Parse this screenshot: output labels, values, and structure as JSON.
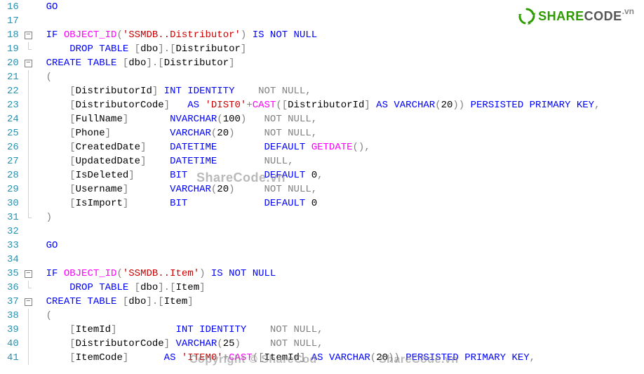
{
  "logo": {
    "brand_left": "SHARE",
    "brand_right": "CODE",
    "tld": ".vn"
  },
  "watermarks": {
    "wm1": "ShareCode.vn",
    "wm2": "Copyright © ShareCod",
    "wm3": "ShareCode.vn"
  },
  "gutter_start": 16,
  "lines": [
    {
      "n": 16,
      "fold": "",
      "tokens": [
        [
          "kw",
          "GO"
        ]
      ]
    },
    {
      "n": 17,
      "fold": "",
      "tokens": []
    },
    {
      "n": 18,
      "fold": "box",
      "tokens": [
        [
          "kw",
          "IF "
        ],
        [
          "fn",
          "OBJECT_ID"
        ],
        [
          "op",
          "("
        ],
        [
          "str",
          "'SSMDB..Distributor'"
        ],
        [
          "op",
          ") "
        ],
        [
          "kw",
          "IS NOT NULL"
        ]
      ]
    },
    {
      "n": 19,
      "fold": "end",
      "tokens": [
        [
          "",
          "    "
        ],
        [
          "kw",
          "DROP TABLE "
        ],
        [
          "op",
          "["
        ],
        [
          "ident",
          "dbo"
        ],
        [
          "op",
          "].["
        ],
        [
          "ident",
          "Distributor"
        ],
        [
          "op",
          "]"
        ]
      ]
    },
    {
      "n": 20,
      "fold": "box",
      "tokens": [
        [
          "kw",
          "CREATE TABLE "
        ],
        [
          "op",
          "["
        ],
        [
          "ident",
          "dbo"
        ],
        [
          "op",
          "].["
        ],
        [
          "ident",
          "Distributor"
        ],
        [
          "op",
          "]"
        ]
      ]
    },
    {
      "n": 21,
      "fold": "line",
      "tokens": [
        [
          "op",
          "("
        ]
      ]
    },
    {
      "n": 22,
      "fold": "line",
      "tokens": [
        [
          "",
          "    "
        ],
        [
          "op",
          "["
        ],
        [
          "ident",
          "DistributorId"
        ],
        [
          "op",
          "] "
        ],
        [
          "kw",
          "INT IDENTITY    "
        ],
        [
          "op",
          "NOT NULL,"
        ]
      ]
    },
    {
      "n": 23,
      "fold": "line",
      "tokens": [
        [
          "",
          "    "
        ],
        [
          "op",
          "["
        ],
        [
          "ident",
          "DistributorCode"
        ],
        [
          "op",
          "]   "
        ],
        [
          "kw",
          "AS "
        ],
        [
          "str",
          "'DIST0'"
        ],
        [
          "op",
          "+"
        ],
        [
          "fn",
          "CAST"
        ],
        [
          "op",
          "(["
        ],
        [
          "ident",
          "DistributorId"
        ],
        [
          "op",
          "] "
        ],
        [
          "kw",
          "AS VARCHAR"
        ],
        [
          "op",
          "("
        ],
        [
          "num",
          "20"
        ],
        [
          "op",
          ")) "
        ],
        [
          "kw",
          "PERSISTED PRIMARY KEY"
        ],
        [
          "op",
          ","
        ]
      ]
    },
    {
      "n": 24,
      "fold": "line",
      "tokens": [
        [
          "",
          "    "
        ],
        [
          "op",
          "["
        ],
        [
          "ident",
          "FullName"
        ],
        [
          "op",
          "]       "
        ],
        [
          "kw",
          "NVARCHAR"
        ],
        [
          "op",
          "("
        ],
        [
          "num",
          "100"
        ],
        [
          "op",
          ")   "
        ],
        [
          "op",
          "NOT NULL,"
        ]
      ]
    },
    {
      "n": 25,
      "fold": "line",
      "tokens": [
        [
          "",
          "    "
        ],
        [
          "op",
          "["
        ],
        [
          "ident",
          "Phone"
        ],
        [
          "op",
          "]          "
        ],
        [
          "kw",
          "VARCHAR"
        ],
        [
          "op",
          "("
        ],
        [
          "num",
          "20"
        ],
        [
          "op",
          ")     "
        ],
        [
          "op",
          "NOT NULL,"
        ]
      ]
    },
    {
      "n": 26,
      "fold": "line",
      "tokens": [
        [
          "",
          "    "
        ],
        [
          "op",
          "["
        ],
        [
          "ident",
          "CreatedDate"
        ],
        [
          "op",
          "]    "
        ],
        [
          "kw",
          "DATETIME        DEFAULT "
        ],
        [
          "fn",
          "GETDATE"
        ],
        [
          "op",
          "(),"
        ]
      ]
    },
    {
      "n": 27,
      "fold": "line",
      "tokens": [
        [
          "",
          "    "
        ],
        [
          "op",
          "["
        ],
        [
          "ident",
          "UpdatedDate"
        ],
        [
          "op",
          "]    "
        ],
        [
          "kw",
          "DATETIME        "
        ],
        [
          "op",
          "NULL,"
        ]
      ]
    },
    {
      "n": 28,
      "fold": "line",
      "tokens": [
        [
          "",
          "    "
        ],
        [
          "op",
          "["
        ],
        [
          "ident",
          "IsDeleted"
        ],
        [
          "op",
          "]      "
        ],
        [
          "kw",
          "BIT             DEFAULT "
        ],
        [
          "num",
          "0"
        ],
        [
          "op",
          ","
        ]
      ]
    },
    {
      "n": 29,
      "fold": "line",
      "tokens": [
        [
          "",
          "    "
        ],
        [
          "op",
          "["
        ],
        [
          "ident",
          "Username"
        ],
        [
          "op",
          "]       "
        ],
        [
          "kw",
          "VARCHAR"
        ],
        [
          "op",
          "("
        ],
        [
          "num",
          "20"
        ],
        [
          "op",
          ")     "
        ],
        [
          "op",
          "NOT NULL,"
        ]
      ]
    },
    {
      "n": 30,
      "fold": "line",
      "tokens": [
        [
          "",
          "    "
        ],
        [
          "op",
          "["
        ],
        [
          "ident",
          "IsImport"
        ],
        [
          "op",
          "]       "
        ],
        [
          "kw",
          "BIT             DEFAULT "
        ],
        [
          "num",
          "0"
        ]
      ]
    },
    {
      "n": 31,
      "fold": "end",
      "tokens": [
        [
          "op",
          ")"
        ]
      ]
    },
    {
      "n": 32,
      "fold": "",
      "tokens": []
    },
    {
      "n": 33,
      "fold": "",
      "tokens": [
        [
          "kw",
          "GO"
        ]
      ]
    },
    {
      "n": 34,
      "fold": "",
      "tokens": []
    },
    {
      "n": 35,
      "fold": "box",
      "tokens": [
        [
          "kw",
          "IF "
        ],
        [
          "fn",
          "OBJECT_ID"
        ],
        [
          "op",
          "("
        ],
        [
          "str",
          "'SSMDB..Item'"
        ],
        [
          "op",
          ") "
        ],
        [
          "kw",
          "IS NOT NULL"
        ]
      ]
    },
    {
      "n": 36,
      "fold": "end",
      "tokens": [
        [
          "",
          "    "
        ],
        [
          "kw",
          "DROP TABLE "
        ],
        [
          "op",
          "["
        ],
        [
          "ident",
          "dbo"
        ],
        [
          "op",
          "].["
        ],
        [
          "ident",
          "Item"
        ],
        [
          "op",
          "]"
        ]
      ]
    },
    {
      "n": 37,
      "fold": "box",
      "tokens": [
        [
          "kw",
          "CREATE TABLE "
        ],
        [
          "op",
          "["
        ],
        [
          "ident",
          "dbo"
        ],
        [
          "op",
          "].["
        ],
        [
          "ident",
          "Item"
        ],
        [
          "op",
          "]"
        ]
      ]
    },
    {
      "n": 38,
      "fold": "line",
      "tokens": [
        [
          "op",
          "("
        ]
      ]
    },
    {
      "n": 39,
      "fold": "line",
      "tokens": [
        [
          "",
          "    "
        ],
        [
          "op",
          "["
        ],
        [
          "ident",
          "ItemId"
        ],
        [
          "op",
          "]          "
        ],
        [
          "kw",
          "INT IDENTITY    "
        ],
        [
          "op",
          "NOT NULL,"
        ]
      ]
    },
    {
      "n": 40,
      "fold": "line",
      "tokens": [
        [
          "",
          "    "
        ],
        [
          "op",
          "["
        ],
        [
          "ident",
          "DistributorCode"
        ],
        [
          "op",
          "] "
        ],
        [
          "kw",
          "VARCHAR"
        ],
        [
          "op",
          "("
        ],
        [
          "num",
          "25"
        ],
        [
          "op",
          ")     "
        ],
        [
          "op",
          "NOT NULL,"
        ]
      ]
    },
    {
      "n": 41,
      "fold": "line",
      "tokens": [
        [
          "",
          "    "
        ],
        [
          "op",
          "["
        ],
        [
          "ident",
          "ItemCode"
        ],
        [
          "op",
          "]      "
        ],
        [
          "kw",
          "AS "
        ],
        [
          "str",
          "'ITEM0'"
        ],
        [
          "op",
          "+"
        ],
        [
          "fn",
          "CAST"
        ],
        [
          "op",
          "(["
        ],
        [
          "ident",
          "ItemId"
        ],
        [
          "op",
          "] "
        ],
        [
          "kw",
          "AS VARCHAR"
        ],
        [
          "op",
          "("
        ],
        [
          "num",
          "20"
        ],
        [
          "op",
          ")) "
        ],
        [
          "kw",
          "PERSISTED PRIMARY KEY"
        ],
        [
          "op",
          ","
        ]
      ]
    }
  ]
}
